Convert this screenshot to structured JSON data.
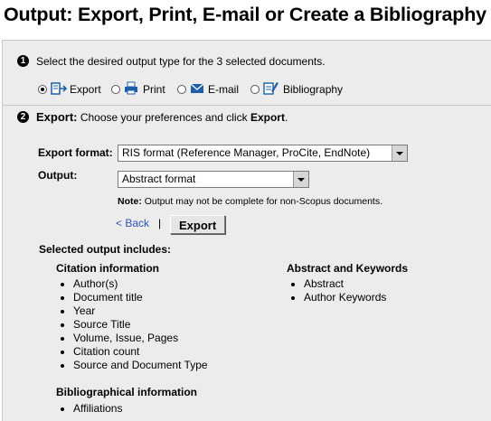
{
  "title": "Output: Export, Print, E-mail or Create a Bibliography",
  "step1": {
    "number": "1",
    "text_before": "Select the desired output type for the ",
    "count": "3",
    "text_after": " selected documents.",
    "options": [
      {
        "label": "Export",
        "icon": "export-icon",
        "selected": true
      },
      {
        "label": "Print",
        "icon": "print-icon",
        "selected": false
      },
      {
        "label": "E-mail",
        "icon": "email-icon",
        "selected": false
      },
      {
        "label": "Bibliography",
        "icon": "bibliography-icon",
        "selected": false
      }
    ]
  },
  "step2": {
    "number": "2",
    "heading": "Export:",
    "text_before": " Choose your preferences and click ",
    "text_strong": "Export",
    "text_after": "."
  },
  "form": {
    "export_format_label": "Export format:",
    "export_format_value": "RIS format (Reference Manager, ProCite, EndNote)",
    "output_label": "Output:",
    "output_value": "Abstract format",
    "note_label": "Note:",
    "note_text": " Output may not be complete for non-Scopus documents.",
    "back_label": "< Back",
    "separator": "|",
    "export_button": "Export"
  },
  "includes": {
    "heading": "Selected output includes:",
    "citation": {
      "heading": "Citation information",
      "items": [
        "Author(s)",
        "Document title",
        "Year",
        "Source Title",
        "Volume, Issue, Pages",
        "Citation count",
        "Source and Document Type"
      ]
    },
    "abstract": {
      "heading": "Abstract and Keywords",
      "items": [
        "Abstract",
        "Author Keywords"
      ]
    },
    "bibliographical": {
      "heading": "Bibliographical information",
      "items": [
        "Affiliations"
      ]
    }
  },
  "colors": {
    "panel_bg": "#ececec",
    "link": "#2a55b8",
    "icon_blue": "#1c5fa8"
  }
}
